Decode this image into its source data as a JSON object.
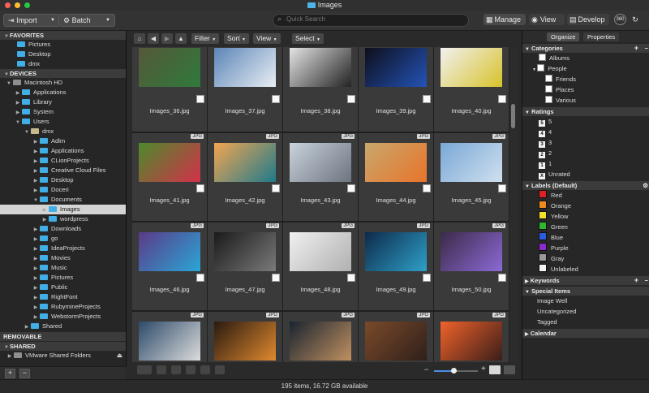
{
  "window": {
    "title": "Images"
  },
  "colors": {
    "folder": "#41aee6",
    "accent": "#4a90e2",
    "selected_row": "#d4d4d4",
    "close": "#fe5f57",
    "minimize": "#febc2e",
    "zoom": "#28c840"
  },
  "toolbar": {
    "import_label": "Import",
    "batch_label": "Batch",
    "search_placeholder": "Quick Search",
    "manage_label": "Manage",
    "view_label": "View",
    "develop_label": "Develop"
  },
  "sidebar": {
    "favorites_title": "FAVORITES",
    "favorites": [
      "Pictures",
      "Desktop",
      "dmx"
    ],
    "devices_title": "DEVICES",
    "device_tree": [
      {
        "label": "Macintosh HD",
        "depth": 1,
        "disc": "▼",
        "icon": "hd"
      },
      {
        "label": "Applications",
        "depth": 2,
        "disc": "▶",
        "icon": "folder"
      },
      {
        "label": "Library",
        "depth": 2,
        "disc": "▶",
        "icon": "folder"
      },
      {
        "label": "System",
        "depth": 2,
        "disc": "▶",
        "icon": "folder"
      },
      {
        "label": "Users",
        "depth": 2,
        "disc": "▼",
        "icon": "folder"
      },
      {
        "label": "dmx",
        "depth": 3,
        "disc": "▼",
        "icon": "home"
      },
      {
        "label": "Adlm",
        "depth": 4,
        "disc": "▶",
        "icon": "folder"
      },
      {
        "label": "Applications",
        "depth": 4,
        "disc": "▶",
        "icon": "folder"
      },
      {
        "label": "CLionProjects",
        "depth": 4,
        "disc": "▶",
        "icon": "folder"
      },
      {
        "label": "Creative Cloud Files",
        "depth": 4,
        "disc": "▶",
        "icon": "folder"
      },
      {
        "label": "Desktop",
        "depth": 4,
        "disc": "▶",
        "icon": "folder"
      },
      {
        "label": "Doceri",
        "depth": 4,
        "disc": "▶",
        "icon": "folder"
      },
      {
        "label": "Documents",
        "depth": 4,
        "disc": "▼",
        "icon": "folder"
      },
      {
        "label": "Images",
        "depth": 5,
        "disc": "▶",
        "icon": "folder",
        "selected": true
      },
      {
        "label": "wordpress",
        "depth": 5,
        "disc": "▶",
        "icon": "folder"
      },
      {
        "label": "Downloads",
        "depth": 4,
        "disc": "▶",
        "icon": "folder"
      },
      {
        "label": "go",
        "depth": 4,
        "disc": "▶",
        "icon": "folder"
      },
      {
        "label": "IdeaProjects",
        "depth": 4,
        "disc": "▶",
        "icon": "folder"
      },
      {
        "label": "Movies",
        "depth": 4,
        "disc": "▶",
        "icon": "folder"
      },
      {
        "label": "Music",
        "depth": 4,
        "disc": "▶",
        "icon": "folder"
      },
      {
        "label": "Pictures",
        "depth": 4,
        "disc": "▶",
        "icon": "folder"
      },
      {
        "label": "Public",
        "depth": 4,
        "disc": "▶",
        "icon": "folder"
      },
      {
        "label": "RightFont",
        "depth": 4,
        "disc": "▶",
        "icon": "folder"
      },
      {
        "label": "RubymineProjects",
        "depth": 4,
        "disc": "▶",
        "icon": "folder"
      },
      {
        "label": "WebstormProjects",
        "depth": 4,
        "disc": "▶",
        "icon": "folder"
      },
      {
        "label": "Shared",
        "depth": 3,
        "disc": "▶",
        "icon": "folder"
      }
    ],
    "removable_title": "REMOVABLE",
    "shared_title": "SHARED",
    "shared": [
      "VMware Shared Folders"
    ]
  },
  "grid_toolbar": {
    "filter": "Filter",
    "sort": "Sort",
    "view": "View",
    "select": "Select"
  },
  "grid": {
    "badge": "JPG",
    "items": [
      {
        "name": "Images_36.jpg",
        "c1": "#55583a",
        "c2": "#2f7a3b"
      },
      {
        "name": "Images_37.jpg",
        "c1": "#5c85b8",
        "c2": "#e9eef4"
      },
      {
        "name": "Images_38.jpg",
        "c1": "#e4e4e4",
        "c2": "#232323"
      },
      {
        "name": "Images_39.jpg",
        "c1": "#0e0e1a",
        "c2": "#2353b8"
      },
      {
        "name": "Images_40.jpg",
        "c1": "#f1f1f1",
        "c2": "#d8c22a"
      },
      {
        "name": "Images_41.jpg",
        "c1": "#4c8a2c",
        "c2": "#d4304a"
      },
      {
        "name": "Images_42.jpg",
        "c1": "#f2a650",
        "c2": "#1f7a8c"
      },
      {
        "name": "Images_43.jpg",
        "c1": "#c9d3dc",
        "c2": "#6d7480"
      },
      {
        "name": "Images_44.jpg",
        "c1": "#c9a76d",
        "c2": "#e8742a"
      },
      {
        "name": "Images_45.jpg",
        "c1": "#7aa8d6",
        "c2": "#cfe0ef"
      },
      {
        "name": "Images_46.jpg",
        "c1": "#5b3a88",
        "c2": "#2aa6d6"
      },
      {
        "name": "Images_47.jpg",
        "c1": "#1a1a1a",
        "c2": "#7a7a7a"
      },
      {
        "name": "Images_48.jpg",
        "c1": "#f0f0f0",
        "c2": "#b0b0b0"
      },
      {
        "name": "Images_49.jpg",
        "c1": "#0d2a4a",
        "c2": "#2fa0c9"
      },
      {
        "name": "Images_50.jpg",
        "c1": "#3b2a48",
        "c2": "#8c6ad6"
      },
      {
        "name": "",
        "c1": "#2d4b6a",
        "c2": "#dcdcdc"
      },
      {
        "name": "",
        "c1": "#2a1a10",
        "c2": "#e0892e"
      },
      {
        "name": "",
        "c1": "#1a2430",
        "c2": "#c09060"
      },
      {
        "name": "",
        "c1": "#7a4a2a",
        "c2": "#30201a"
      },
      {
        "name": "",
        "c1": "#f1622a",
        "c2": "#3a1e1a"
      }
    ]
  },
  "status": {
    "text": "195 items, 16.72 GB available",
    "zoom": 0.45
  },
  "right_panel": {
    "tabs": [
      "Organize",
      "Properties"
    ],
    "categories_title": "Categories",
    "categories": [
      {
        "label": "Albums",
        "indent": 1
      },
      {
        "label": "People",
        "indent": 1
      },
      {
        "label": "Friends",
        "indent": 2
      },
      {
        "label": "Places",
        "indent": 2
      },
      {
        "label": "Various",
        "indent": 2
      }
    ],
    "ratings_title": "Ratings",
    "ratings": [
      {
        "num": "5",
        "label": "5"
      },
      {
        "num": "4",
        "label": "4"
      },
      {
        "num": "3",
        "label": "3"
      },
      {
        "num": "2",
        "label": "2"
      },
      {
        "num": "1",
        "label": "1"
      },
      {
        "num": "X",
        "label": "Unrated"
      }
    ],
    "labels_title": "Labels (Default)",
    "labels": [
      {
        "label": "Red",
        "color": "#e02020"
      },
      {
        "label": "Orange",
        "color": "#f08a1c"
      },
      {
        "label": "Yellow",
        "color": "#f2e02a"
      },
      {
        "label": "Green",
        "color": "#2bb82b"
      },
      {
        "label": "Blue",
        "color": "#2a5ce0"
      },
      {
        "label": "Purple",
        "color": "#8a2ad0"
      },
      {
        "label": "Gray",
        "color": "#9a9a9a"
      },
      {
        "label": "Unlabeled",
        "color": "#f4f4f4"
      }
    ],
    "keywords_title": "Keywords",
    "special_title": "Special Items",
    "special": [
      "Image Well",
      "Uncategorized",
      "Tagged"
    ],
    "calendar_title": "Calendar"
  }
}
